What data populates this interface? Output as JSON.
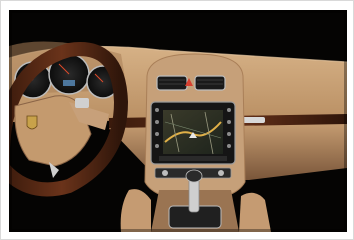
{
  "image": {
    "subject": "car-interior-dashboard",
    "colors": {
      "background": "#050403",
      "leather": "#c9a27a",
      "leather_dark": "#8a6446",
      "wood": "#5a2a14",
      "screen": "#1a1f1a",
      "map_road": "#e0b048",
      "silver": "#c8c8c8"
    }
  }
}
